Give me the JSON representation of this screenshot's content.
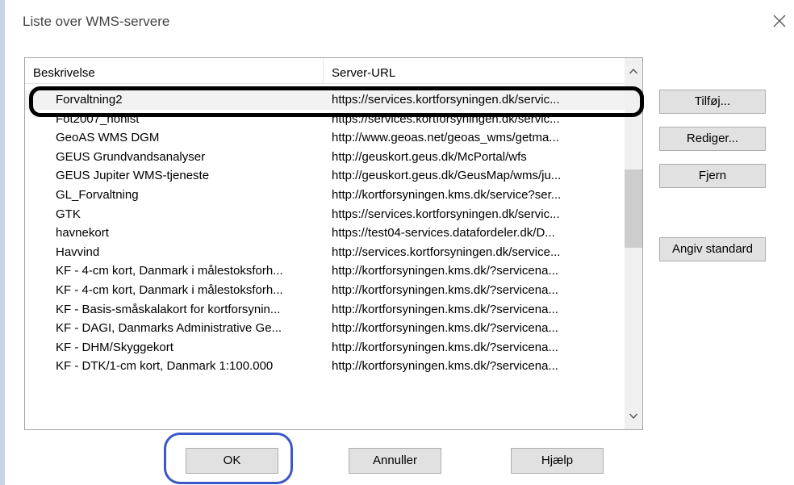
{
  "dialog": {
    "title": "Liste over WMS-servere"
  },
  "icons": {
    "close": "close-icon",
    "scroll_up": "chevron-up-icon",
    "scroll_down": "chevron-down-icon"
  },
  "list": {
    "columns": [
      "Beskrivelse",
      "Server-URL"
    ],
    "rows": [
      {
        "description": "Forvaltning2",
        "url": "https://services.kortforsyningen.dk/servic...",
        "selected": true
      },
      {
        "description": "Fot2007_nohist",
        "url": "https://services.kortforsyningen.dk/servic..."
      },
      {
        "description": "GeoAS WMS DGM",
        "url": "http://www.geoas.net/geoas_wms/getma..."
      },
      {
        "description": "GEUS Grundvandsanalyser",
        "url": "http://geuskort.geus.dk/McPortal/wfs"
      },
      {
        "description": "GEUS Jupiter WMS-tjeneste",
        "url": "http://geuskort.geus.dk/GeusMap/wms/ju..."
      },
      {
        "description": "GL_Forvaltning",
        "url": "http://kortforsyningen.kms.dk/service?ser..."
      },
      {
        "description": "GTK",
        "url": "https://services.kortforsyningen.dk/servic..."
      },
      {
        "description": "havnekort",
        "url": "https://test04-services.datafordeler.dk/D..."
      },
      {
        "description": "Havvind",
        "url": "http://services.kortforsyningen.dk/service..."
      },
      {
        "description": "KF - 4-cm kort, Danmark i målestoksforh...",
        "url": "http://kortforsyningen.kms.dk/?servicena..."
      },
      {
        "description": "KF - 4-cm kort, Danmark i målestoksforh...",
        "url": "http://kortforsyningen.kms.dk/?servicena..."
      },
      {
        "description": "KF - Basis-småskalakort for kortforsynin...",
        "url": "http://kortforsyningen.kms.dk/?servicena..."
      },
      {
        "description": "KF - DAGI, Danmarks Administrative Ge...",
        "url": "http://kortforsyningen.kms.dk/?servicena..."
      },
      {
        "description": "KF - DHM/Skyggekort",
        "url": "http://kortforsyningen.kms.dk/?servicena..."
      },
      {
        "description": "KF - DTK/1-cm kort, Danmark 1:100.000",
        "url": "http://kortforsyningen.kms.dk/?servicena..."
      }
    ]
  },
  "side_buttons": {
    "add": "Tilføj...",
    "edit": "Rediger...",
    "remove": "Fjern",
    "set_default": "Angiv standard"
  },
  "bottom_buttons": {
    "ok": "OK",
    "cancel": "Annuller",
    "help": "Hjælp"
  },
  "annotations": {
    "row_highlight_color": "#000000",
    "ok_highlight_color": "#3b57c9"
  }
}
